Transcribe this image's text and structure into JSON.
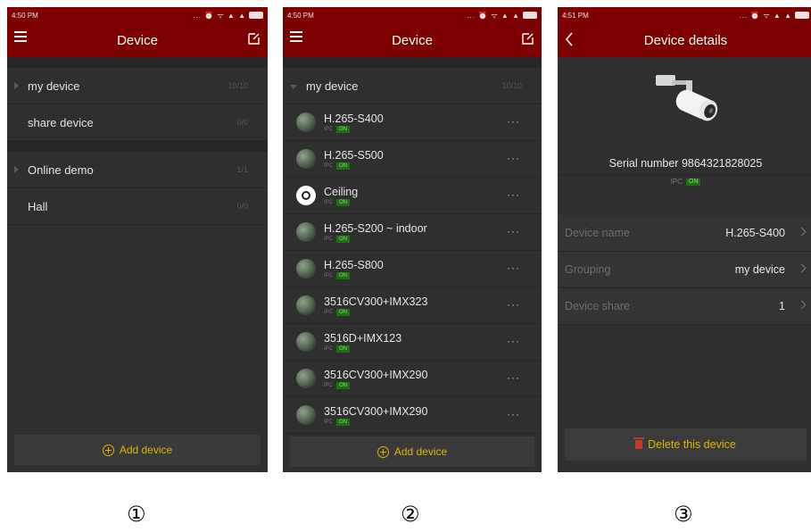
{
  "screen1": {
    "time": "4:50 PM",
    "status_icons": "... ⏰ ᯤ ▲ ▲",
    "title": "Device",
    "groups": [
      {
        "label": "my device",
        "count": "10/10",
        "arrow": true
      },
      {
        "label": "share device",
        "count": "0/0",
        "arrow": false
      },
      {
        "label": "Online demo",
        "count": "1/1",
        "arrow": true
      },
      {
        "label": "Hall",
        "count": "0/0",
        "arrow": false
      }
    ],
    "add_label": "Add device",
    "caption": "①"
  },
  "screen2": {
    "time": "4:50 PM",
    "status_icons": "... ⏰ ᯤ ▲ ▲",
    "title": "Device",
    "group_label": "my device",
    "group_count": "10/10",
    "devices": [
      {
        "name": "H.265-S400",
        "type": "IPC",
        "status": "ON",
        "more": "···"
      },
      {
        "name": "H.265-S500",
        "type": "IPC",
        "status": "ON",
        "more": "···"
      },
      {
        "name": "Ceiling",
        "type": "IPC",
        "status": "ON",
        "more": "···"
      },
      {
        "name": "H.265-S200 ~ indoor",
        "type": "IPC",
        "status": "ON",
        "more": "···"
      },
      {
        "name": "H.265-S800",
        "type": "IPC",
        "status": "ON",
        "more": "···"
      },
      {
        "name": "3516CV300+IMX323",
        "type": "IPC",
        "status": "ON",
        "more": "···"
      },
      {
        "name": "3516D+IMX123",
        "type": "IPC",
        "status": "ON",
        "more": "···"
      },
      {
        "name": "3516CV300+IMX290",
        "type": "IPC",
        "status": "ON",
        "more": "···"
      },
      {
        "name": "3516CV300+IMX290",
        "type": "IPC",
        "status": "ON",
        "more": "···"
      }
    ],
    "add_label": "Add device",
    "caption": "②"
  },
  "screen3": {
    "time": "4:51 PM",
    "status_icons": "... ⏰ ᯤ ▲ ▲",
    "title": "Device details",
    "serial": "Serial number 9864321828025",
    "type": "IPC",
    "status": "ON",
    "rows": [
      {
        "label": "Device name",
        "value": "H.265-S400"
      },
      {
        "label": "Grouping",
        "value": "my device"
      },
      {
        "label": "Device share",
        "value": "1"
      }
    ],
    "delete_label": "Delete this device",
    "caption": "③"
  },
  "colors": {
    "header": "#7d0000",
    "accent": "#d9b600",
    "on_badge": "#1f6e14",
    "bg": "#2f2f2f"
  }
}
